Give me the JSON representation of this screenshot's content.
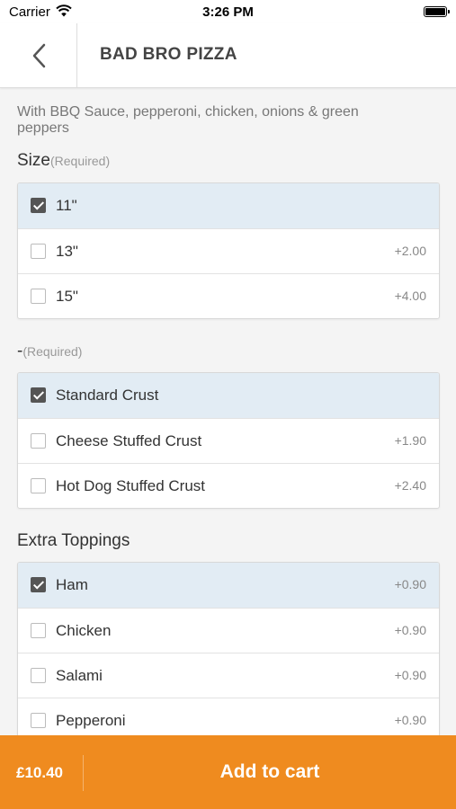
{
  "status_bar": {
    "carrier": "Carrier",
    "time": "3:26 PM"
  },
  "nav": {
    "title": "BAD BRO PIZZA",
    "back_icon": "chevron-left-icon"
  },
  "description": "With BBQ Sauce, pepperoni, chicken, onions & green peppers",
  "sections": [
    {
      "title": "Size",
      "required": "(Required)",
      "options": [
        {
          "label": "11\"",
          "price": "",
          "checked": true
        },
        {
          "label": "13\"",
          "price": "+2.00",
          "checked": false
        },
        {
          "label": "15\"",
          "price": "+4.00",
          "checked": false
        }
      ]
    },
    {
      "title": "-",
      "required": "(Required)",
      "options": [
        {
          "label": "Standard Crust",
          "price": "",
          "checked": true
        },
        {
          "label": "Cheese Stuffed Crust",
          "price": "+1.90",
          "checked": false
        },
        {
          "label": "Hot Dog Stuffed Crust",
          "price": "+2.40",
          "checked": false
        }
      ]
    },
    {
      "title": "Extra Toppings",
      "required": "",
      "options": [
        {
          "label": "Ham",
          "price": "+0.90",
          "checked": true
        },
        {
          "label": "Chicken",
          "price": "+0.90",
          "checked": false
        },
        {
          "label": "Salami",
          "price": "+0.90",
          "checked": false
        },
        {
          "label": "Pepperoni",
          "price": "+0.90",
          "checked": false
        }
      ]
    }
  ],
  "footer": {
    "total": "£10.40",
    "add_label": "Add to cart"
  },
  "colors": {
    "accent": "#ef8b1f",
    "selected_row": "#e2ecf4"
  }
}
